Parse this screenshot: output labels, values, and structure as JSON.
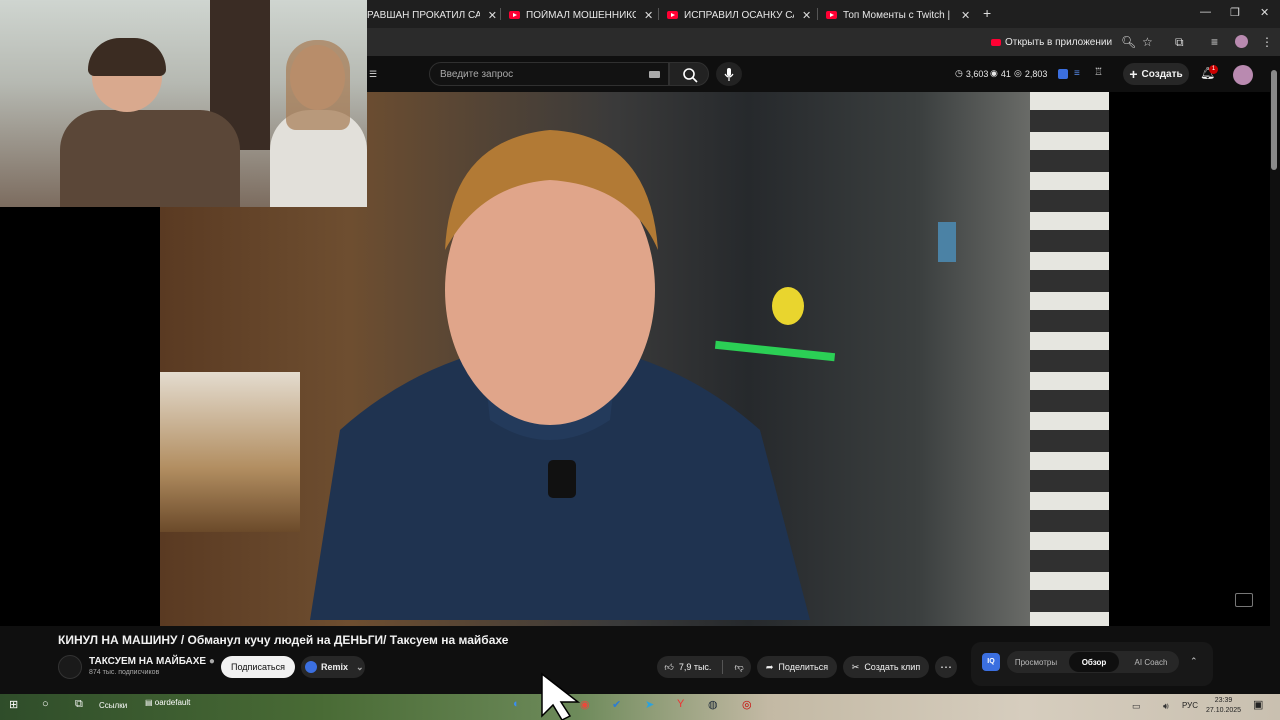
{
  "browser": {
    "tabs": [
      {
        "label": "РАВШАН ПРОКАТИЛ САБИНУ",
        "close": "✕"
      },
      {
        "label": "ПОЙМАЛ МОШЕННИКОВ И ЗА",
        "close": "✕"
      },
      {
        "label": "ИСПРАВИЛ ОСАНКУ САМЫМ",
        "close": "✕"
      },
      {
        "label": "Топ Моменты с Twitch | Кукин",
        "close": "✕"
      }
    ],
    "new_tab": "+",
    "open_in_app": "Открыть в приложении"
  },
  "youtube": {
    "search_placeholder": "Введите запрос",
    "stats": {
      "first": "3,603",
      "second": "41",
      "third": "2,803"
    },
    "create_label": "Создать",
    "notification_count": "1"
  },
  "video": {
    "title": "КИНУЛ НА МАШИНУ / Обманул кучу людей на ДЕНЬГИ/ Таксуем на майбахе",
    "channel_name": "ТАКСУЕМ НА МАЙБАХЕ",
    "subscribers": "874 тыс. подписчиков",
    "subscribe_label": "Подписаться",
    "remix_label": "Remix",
    "likes": "7,9 тыс.",
    "share_label": "Поделиться",
    "clip_label": "Создать клип",
    "more_label": "⋯"
  },
  "side_panel": {
    "badge": "IQ",
    "tabs": [
      "Просмотры",
      "Обзор",
      "AI Coach"
    ],
    "active_tab": "Обзор"
  },
  "taskbar": {
    "links_label": "Ссылки",
    "default_label": "oardefault",
    "lang": "РУС",
    "time": "23:39",
    "date": "27.10.2025"
  },
  "colors": {
    "accent_red": "#ff0033",
    "bg": "#0f0f0f",
    "iq_blue": "#3b6fe0"
  }
}
